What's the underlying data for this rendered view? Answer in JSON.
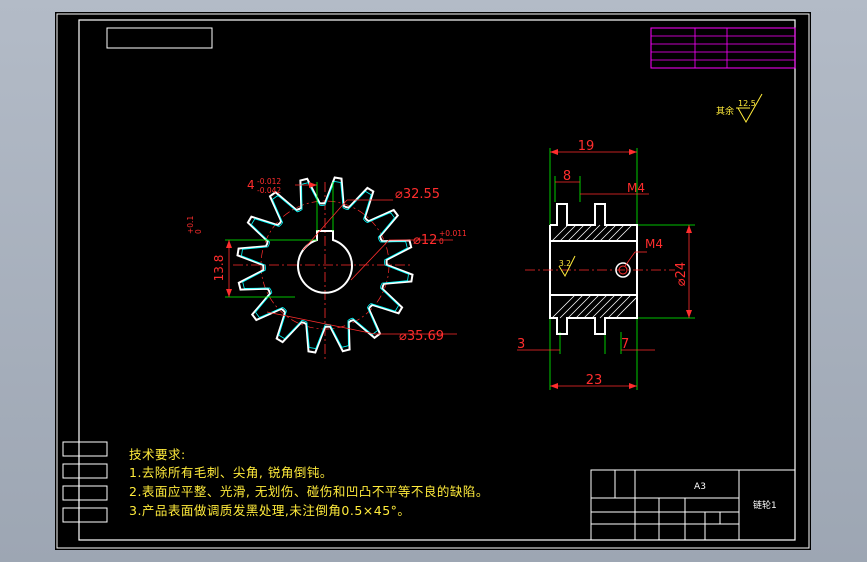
{
  "drawing": {
    "title_block": {
      "sheet_size": "A3",
      "part_name": "链轮1"
    },
    "roughness_note": {
      "label": "其余",
      "value": "12.5"
    },
    "sprocket_front": {
      "dim_chamfer": "4",
      "dim_chamfer_tol_top": "-0.012",
      "dim_chamfer_tol_bot": "-0.042",
      "dim_keyway": "13.8",
      "dim_keyway_tol_top": "+0.1",
      "dim_keyway_tol_bot": "0",
      "dim_tip": "⌀32.55",
      "dim_bore": "⌀12",
      "dim_bore_tol_top": "+0.011",
      "dim_bore_tol_bot": "0",
      "dim_root": "⌀35.69"
    },
    "sprocket_side": {
      "dim_19": "19",
      "dim_8": "8",
      "dim_m4_top": "M4",
      "dim_m4_side": "M4",
      "dim_phi24": "⌀24",
      "dim_3": "3",
      "dim_7": "7",
      "dim_23": "23",
      "roughness_inner": "3.2"
    },
    "requirements": {
      "heading": "技术要求:",
      "items": [
        "1.去除所有毛刺、尖角, 锐角倒钝。",
        "2.表面应平整、光滑, 无划伤、碰伤和凹凸不平等不良的缺陷。",
        "3.产品表面做调质发黑处理,未注倒角0.5×45°。"
      ]
    },
    "colors": {
      "sheet": "#000000",
      "outline": "#ffffff",
      "dimension": "#ff2d2d",
      "extension": "#00ff00",
      "part": "#ffffff",
      "hidden": "#00ffff",
      "text": "#ffeb3b",
      "table": "#ff00ff"
    }
  }
}
